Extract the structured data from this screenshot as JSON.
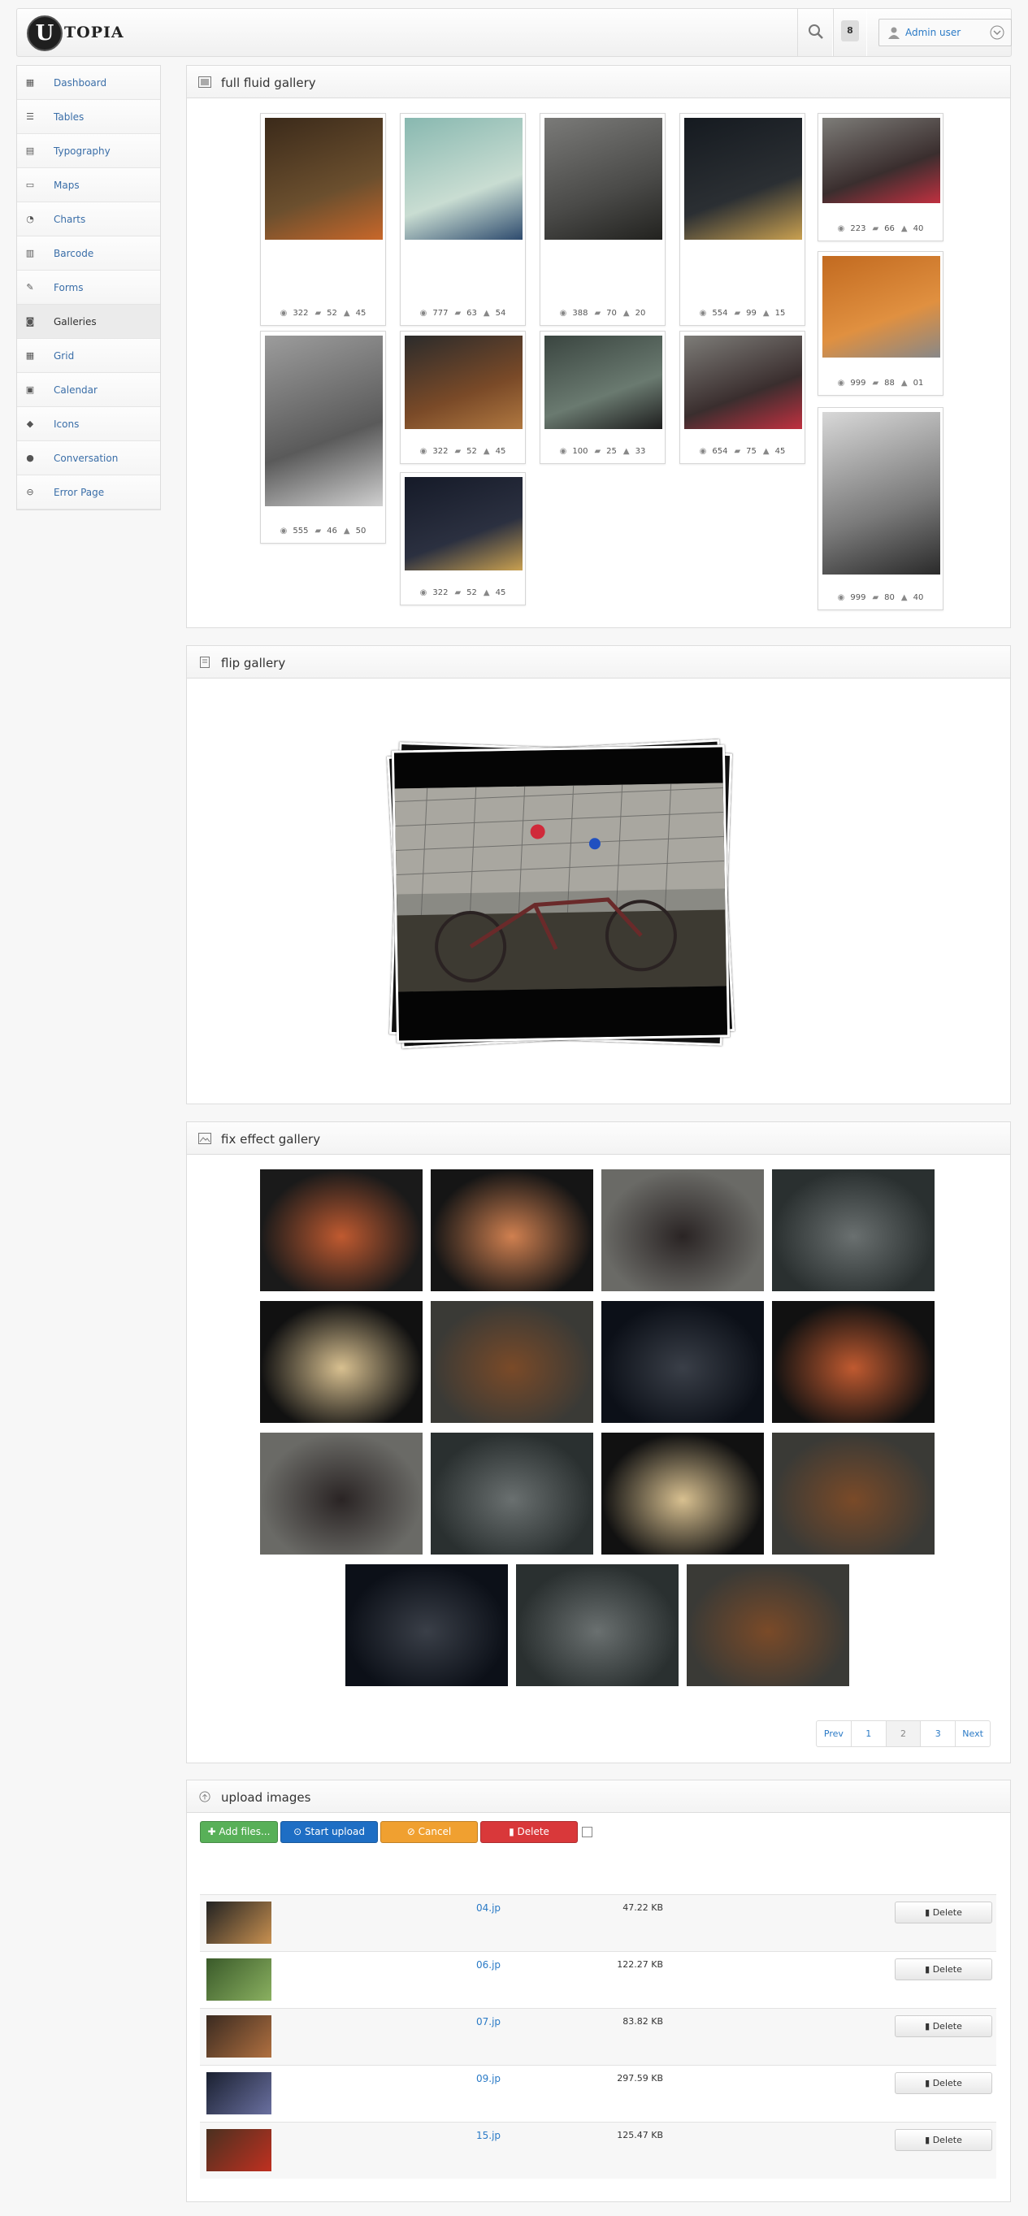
{
  "header": {
    "logo_letter": "U",
    "logo_text": "TOPIA",
    "notifications": "8",
    "user": "Admin user"
  },
  "sidebar": {
    "items": [
      {
        "label": "Dashboard",
        "icon": "dashboard-icon"
      },
      {
        "label": "Tables",
        "icon": "list-icon"
      },
      {
        "label": "Typography",
        "icon": "typography-icon"
      },
      {
        "label": "Maps",
        "icon": "laptop-icon"
      },
      {
        "label": "Charts",
        "icon": "pie-chart-icon"
      },
      {
        "label": "Barcode",
        "icon": "barcode-icon"
      },
      {
        "label": "Forms",
        "icon": "pencil-icon"
      },
      {
        "label": "Galleries",
        "icon": "camera-icon"
      },
      {
        "label": "Grid",
        "icon": "grid-icon"
      },
      {
        "label": "Calendar",
        "icon": "calendar-icon"
      },
      {
        "label": "Icons",
        "icon": "tag-icon"
      },
      {
        "label": "Conversation",
        "icon": "chat-icon"
      },
      {
        "label": "Error Page",
        "icon": "minus-circle-icon"
      }
    ],
    "active": "Galleries"
  },
  "gallery1": {
    "title": "full fluid gallery",
    "tiles": [
      {
        "views": "322",
        "comments": "52",
        "likes": "45",
        "colors": [
          "#3b2a1a",
          "#6b4f2e",
          "#c8672a"
        ]
      },
      {
        "views": "777",
        "comments": "63",
        "likes": "54",
        "colors": [
          "#88b8b0",
          "#c9ddd2",
          "#2e4b6e"
        ]
      },
      {
        "views": "388",
        "comments": "70",
        "likes": "20",
        "colors": [
          "#7a7a78",
          "#4a4a48",
          "#22221f"
        ]
      },
      {
        "views": "554",
        "comments": "99",
        "likes": "15",
        "colors": [
          "#151a20",
          "#2b2f33",
          "#c9a050"
        ]
      },
      {
        "views": "223",
        "comments": "66",
        "likes": "40",
        "colors": [
          "#7d7c78",
          "#3a2e2e",
          "#c03040"
        ]
      },
      {
        "views": "999",
        "comments": "88",
        "likes": "01",
        "colors": [
          "#c26a20",
          "#e09040",
          "#888888"
        ]
      },
      {
        "views": "555",
        "comments": "46",
        "likes": "50",
        "colors": [
          "#9c9c9c",
          "#5a5a5a",
          "#d0d0d0"
        ]
      },
      {
        "views": "322",
        "comments": "52",
        "likes": "45",
        "colors": [
          "#2b2b2b",
          "#7a4a28",
          "#b07840"
        ]
      },
      {
        "views": "100",
        "comments": "25",
        "likes": "33",
        "colors": [
          "#3a4540",
          "#6a7a70",
          "#1e1e1e"
        ]
      },
      {
        "views": "654",
        "comments": "75",
        "likes": "45",
        "colors": [
          "#7d7c78",
          "#3a2e2e",
          "#c03040"
        ]
      },
      {
        "views": "999",
        "comments": "80",
        "likes": "40",
        "colors": [
          "#d8d8d8",
          "#7a7a7a",
          "#2a2a2a"
        ]
      },
      {
        "views": "322",
        "comments": "52",
        "likes": "45",
        "colors": [
          "#151a28",
          "#2b3040",
          "#c9a050"
        ]
      }
    ]
  },
  "gallery2": {
    "title": "flip gallery"
  },
  "gallery3": {
    "title": "fix effect gallery",
    "pager": {
      "prev": "Prev",
      "pages": [
        "1",
        "2",
        "3"
      ],
      "current": "2",
      "next": "Next"
    }
  },
  "upload": {
    "title": "upload images",
    "buttons": {
      "add": "Add files...",
      "start": "Start upload",
      "cancel": "Cancel",
      "delete": "Delete"
    },
    "files": [
      {
        "name": "04.jp",
        "size": "47.22 KB",
        "delete": "Delete"
      },
      {
        "name": "06.jp",
        "size": "122.27 KB",
        "delete": "Delete"
      },
      {
        "name": "07.jp",
        "size": "83.82 KB",
        "delete": "Delete"
      },
      {
        "name": "09.jp",
        "size": "297.59 KB",
        "delete": "Delete"
      },
      {
        "name": "15.jp",
        "size": "125.47 KB",
        "delete": "Delete"
      }
    ]
  }
}
